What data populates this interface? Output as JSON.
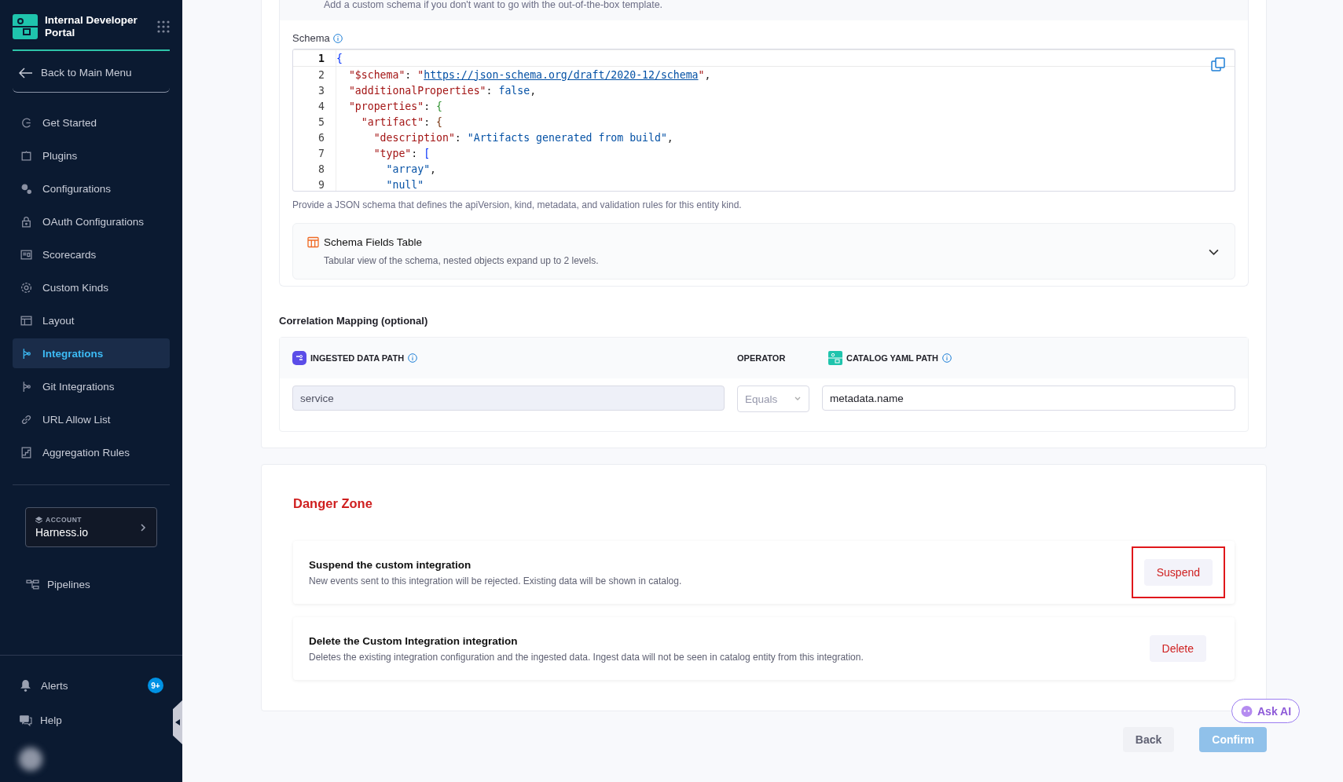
{
  "sidebar": {
    "title": "Internal Developer Portal",
    "back_link": "Back to Main Menu",
    "items": [
      {
        "label": "Get Started",
        "selected": false
      },
      {
        "label": "Plugins",
        "selected": false
      },
      {
        "label": "Configurations",
        "selected": false
      },
      {
        "label": "OAuth Configurations",
        "selected": false
      },
      {
        "label": "Scorecards",
        "selected": false
      },
      {
        "label": "Custom Kinds",
        "selected": false
      },
      {
        "label": "Layout",
        "selected": false
      },
      {
        "label": "Integrations",
        "selected": true
      },
      {
        "label": "Git Integrations",
        "selected": false
      },
      {
        "label": "URL Allow List",
        "selected": false
      },
      {
        "label": "Aggregation Rules",
        "selected": false
      }
    ],
    "account": {
      "caption": "ACCOUNT",
      "name": "Harness.io"
    },
    "pipelines": "Pipelines",
    "alerts": {
      "label": "Alerts",
      "badge": "9+"
    },
    "help": "Help"
  },
  "schema_section": {
    "hint": "Add a custom schema if you don't want to go with the out-of-the-box template.",
    "label": "Schema",
    "editor_lines": [
      {
        "number": "1",
        "current": true,
        "tokens": [
          {
            "kind": "brace1",
            "text": "{"
          }
        ]
      },
      {
        "number": "2",
        "current": false,
        "tokens": [
          {
            "kind": "key",
            "text": "  \"$schema\""
          },
          {
            "kind": "punct",
            "text": ": "
          },
          {
            "kind": "key",
            "text": "\""
          },
          {
            "kind": "link",
            "text": "https://json-schema.org/draft/2020-12/schema"
          },
          {
            "kind": "key",
            "text": "\""
          },
          {
            "kind": "punct",
            "text": ","
          }
        ]
      },
      {
        "number": "3",
        "current": false,
        "tokens": [
          {
            "kind": "key",
            "text": "  \"additionalProperties\""
          },
          {
            "kind": "punct",
            "text": ": "
          },
          {
            "kind": "value",
            "text": "false"
          },
          {
            "kind": "punct",
            "text": ","
          }
        ]
      },
      {
        "number": "4",
        "current": false,
        "tokens": [
          {
            "kind": "key",
            "text": "  \"properties\""
          },
          {
            "kind": "punct",
            "text": ": "
          },
          {
            "kind": "brace2",
            "text": "{"
          }
        ]
      },
      {
        "number": "5",
        "current": false,
        "tokens": [
          {
            "kind": "key",
            "text": "    \"artifact\""
          },
          {
            "kind": "punct",
            "text": ": "
          },
          {
            "kind": "brace3",
            "text": "{"
          }
        ]
      },
      {
        "number": "6",
        "current": false,
        "tokens": [
          {
            "kind": "key",
            "text": "      \"description\""
          },
          {
            "kind": "punct",
            "text": ": "
          },
          {
            "kind": "value",
            "text": "\"Artifacts generated from build\""
          },
          {
            "kind": "punct",
            "text": ","
          }
        ]
      },
      {
        "number": "7",
        "current": false,
        "tokens": [
          {
            "kind": "key",
            "text": "      \"type\""
          },
          {
            "kind": "punct",
            "text": ": "
          },
          {
            "kind": "brace1",
            "text": "["
          }
        ]
      },
      {
        "number": "8",
        "current": false,
        "tokens": [
          {
            "kind": "value",
            "text": "        \"array\""
          },
          {
            "kind": "punct",
            "text": ","
          }
        ]
      },
      {
        "number": "9",
        "current": false,
        "tokens": [
          {
            "kind": "value",
            "text": "        \"null\""
          }
        ]
      }
    ],
    "helper": "Provide a JSON schema that defines the apiVersion, kind, metadata, and validation rules for this entity kind.",
    "fields_table": {
      "title": "Schema Fields Table",
      "subtitle": "Tabular view of the schema, nested objects expand up to 2 levels.",
      "expanded": false
    }
  },
  "correlation": {
    "title": "Correlation Mapping (optional)",
    "columns": [
      "INGESTED DATA PATH",
      "OPERATOR",
      "CATALOG YAML PATH"
    ],
    "row": {
      "ingested_path": "service",
      "operator": "Equals",
      "catalog_path": "metadata.name"
    }
  },
  "danger_zone": {
    "title": "Danger Zone",
    "actions": [
      {
        "title": "Suspend the custom integration",
        "description": "New events sent to this integration will be rejected. Existing data will be shown in catalog.",
        "button": "Suspend",
        "highlighted": true
      },
      {
        "title": "Delete the Custom Integration integration",
        "description": "Deletes the existing integration configuration and the ingested data. Ingest data will not be seen in catalog entity from this integration.",
        "button": "Delete",
        "highlighted": false
      }
    ]
  },
  "ask_ai": "Ask AI",
  "footer": {
    "back": "Back",
    "confirm": "Confirm",
    "confirm_disabled": true
  }
}
